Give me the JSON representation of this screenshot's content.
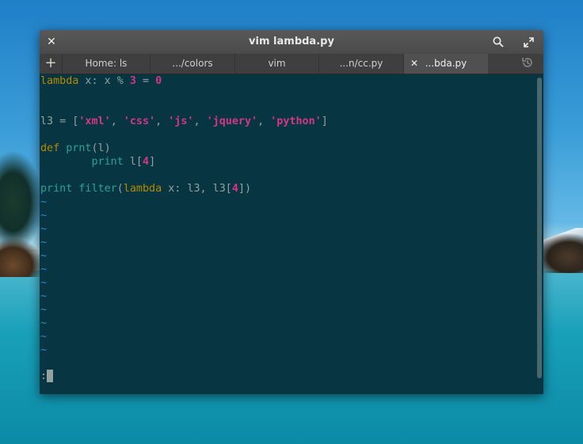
{
  "window": {
    "title": "vim lambda.py"
  },
  "tabs": [
    {
      "label": "Home: ls",
      "active": false
    },
    {
      "label": ".../colors",
      "active": false
    },
    {
      "label": "vim",
      "active": false
    },
    {
      "label": "...n/cc.py",
      "active": false
    },
    {
      "label": "...bda.py",
      "active": true
    }
  ],
  "icons": {
    "close": "close-icon",
    "search": "search-icon",
    "maximize": "maximize-icon",
    "new_tab": "plus-icon",
    "tab_close": "close-icon",
    "history": "history-icon"
  },
  "colors": {
    "terminal_bg": "#073642",
    "keyword": "#b58900",
    "function": "#2aa198",
    "number": "#d33682",
    "string": "#d33682",
    "tilde": "#268bd2",
    "text": "#93a1a1"
  },
  "editor": {
    "line1": {
      "kw": "lambda",
      "mid": " x: x % ",
      "n1": "3",
      "eq": " = ",
      "n2": "0"
    },
    "line4": {
      "prefix": "l3 = [",
      "s1": "'xml'",
      "c1": ", ",
      "s2": "'css'",
      "c2": ", ",
      "s3": "'js'",
      "c3": ", ",
      "s4": "'jquery'",
      "c4": ", ",
      "s5": "'python'",
      "suffix": "]"
    },
    "line6": {
      "kw": "def",
      "sp": " ",
      "fn": "prnt",
      "rest": "(l)"
    },
    "line7": {
      "indent": "        ",
      "fn": "print",
      "mid": " l[",
      "n": "4",
      "end": "]"
    },
    "line9": {
      "fn1": "print",
      "sp1": " ",
      "fn2": "filter",
      "open": "(",
      "kw": "lambda",
      "mid": " x: l3, l3[",
      "n": "4",
      "end": "])"
    },
    "tilde_char": "~",
    "tilde_count": 12,
    "command_prompt": ":"
  }
}
